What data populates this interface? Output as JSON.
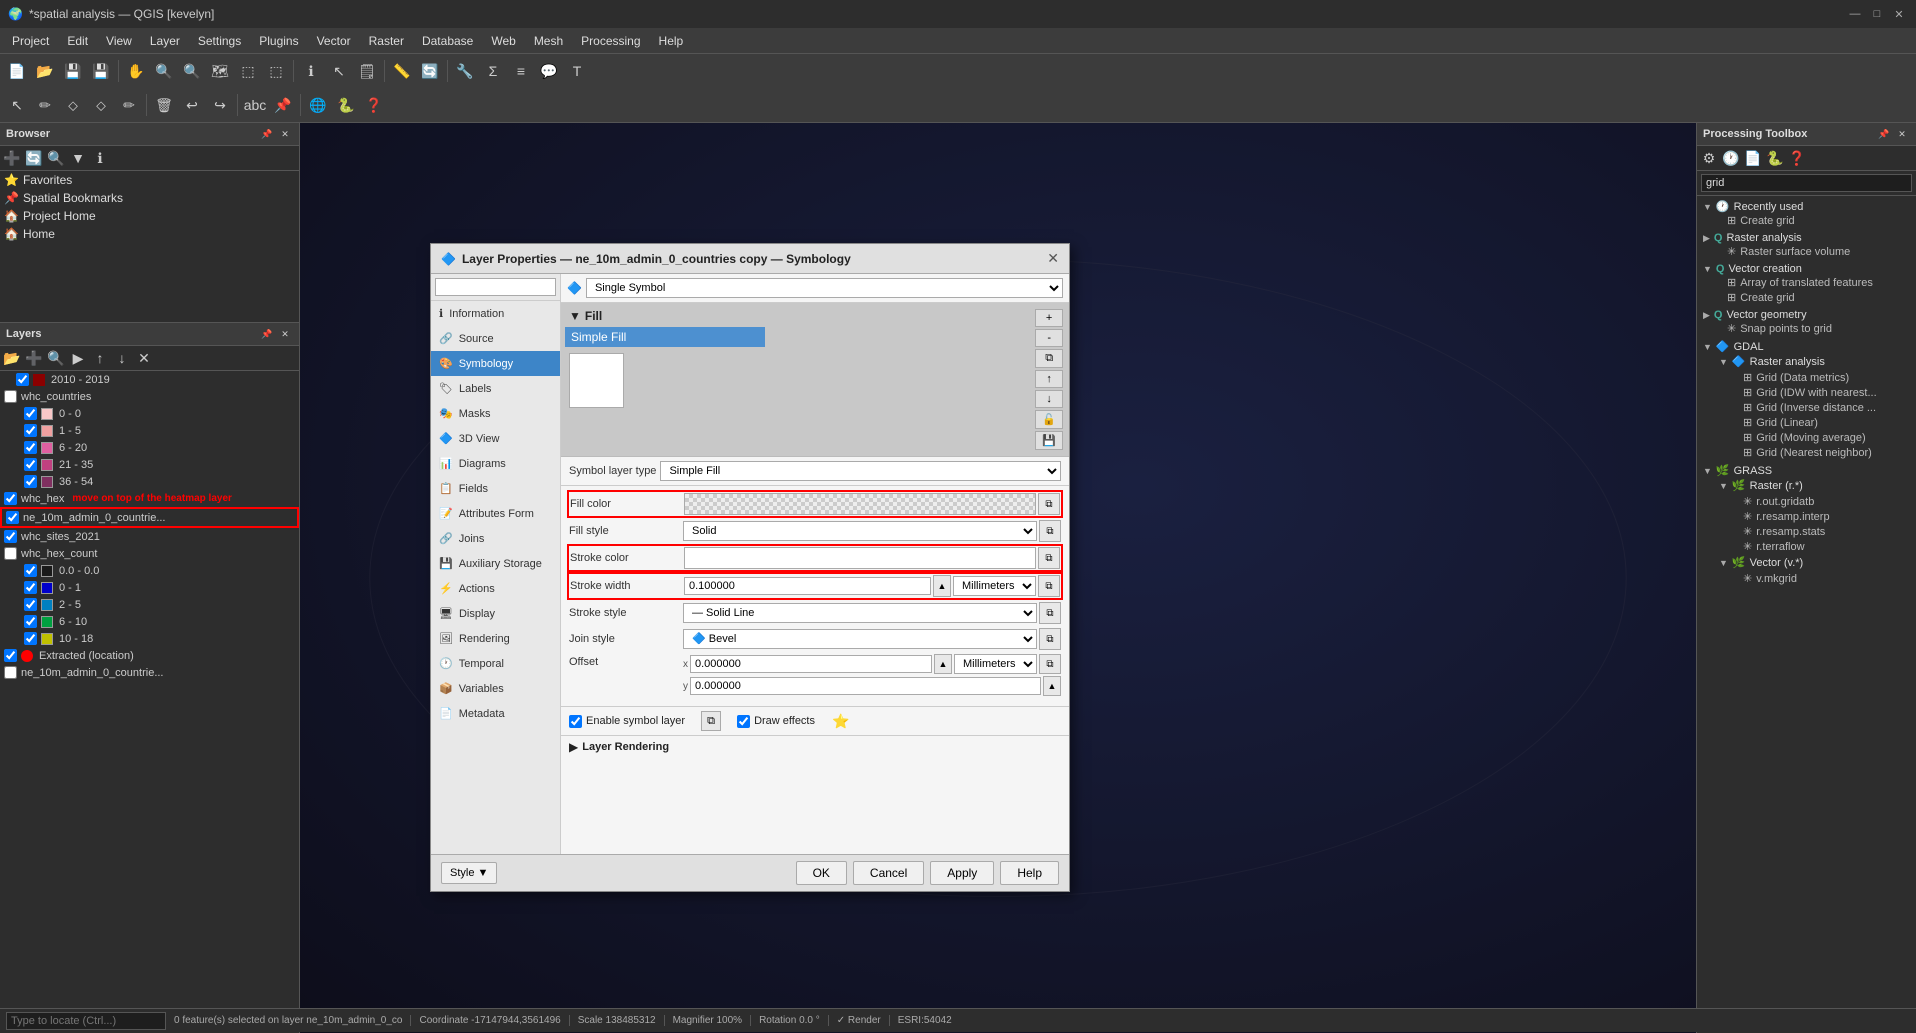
{
  "app": {
    "title": "*spatial analysis — QGIS [kevelyn]",
    "icon": "🌍"
  },
  "titlebar": {
    "minimize": "—",
    "maximize": "□",
    "close": "✕"
  },
  "menu": {
    "items": [
      "Project",
      "Edit",
      "View",
      "Layer",
      "Settings",
      "Plugins",
      "Vector",
      "Raster",
      "Database",
      "Web",
      "Mesh",
      "Processing",
      "Help"
    ]
  },
  "browser": {
    "title": "Browser",
    "items": [
      {
        "label": "Favorites",
        "icon": "⭐"
      },
      {
        "label": "Spatial Bookmarks",
        "icon": "📌"
      },
      {
        "label": "Project Home",
        "icon": "🏠"
      },
      {
        "label": "Home",
        "icon": "🏠"
      }
    ]
  },
  "layers": {
    "title": "Layers",
    "items": [
      {
        "label": "2010 - 2019",
        "color": "#8b0000",
        "checked": true,
        "indent": 1
      },
      {
        "label": "whc_countries",
        "color": null,
        "checked": false,
        "indent": 0
      },
      {
        "label": "0 - 0",
        "color": "#f8c8c8",
        "checked": true,
        "indent": 2
      },
      {
        "label": "1 - 5",
        "color": "#f0a0a0",
        "checked": true,
        "indent": 2
      },
      {
        "label": "6 - 20",
        "color": "#e060a0",
        "checked": true,
        "indent": 2
      },
      {
        "label": "21 - 35",
        "color": "#c04080",
        "checked": true,
        "indent": 2
      },
      {
        "label": "36 - 54",
        "color": "#803060",
        "checked": true,
        "indent": 2
      },
      {
        "label": "whc_hex",
        "color": null,
        "checked": true,
        "indent": 0
      },
      {
        "label": "ne_10m_admin_0_countrie...",
        "color": null,
        "checked": true,
        "indent": 0,
        "selected": true
      },
      {
        "label": "whc_sites_2021",
        "color": null,
        "checked": true,
        "indent": 0
      },
      {
        "label": "whc_hex_count",
        "color": null,
        "checked": false,
        "indent": 0
      },
      {
        "label": "0.0 - 0.0",
        "color": "#1a1a1a",
        "checked": true,
        "indent": 2
      },
      {
        "label": "0 - 1",
        "color": "#0000cc",
        "checked": true,
        "indent": 2
      },
      {
        "label": "2 - 5",
        "color": "#0080c0",
        "checked": true,
        "indent": 2
      },
      {
        "label": "6 - 10",
        "color": "#00a040",
        "checked": true,
        "indent": 2
      },
      {
        "label": "10 - 18",
        "color": "#c0c000",
        "checked": true,
        "indent": 2
      },
      {
        "label": "Extracted (location)",
        "color": "#ff0000",
        "checked": true,
        "indent": 0
      },
      {
        "label": "ne_10m_admin_0_countrie...",
        "color": null,
        "checked": false,
        "indent": 0
      }
    ],
    "annotation": "move on top of the heatmap layer"
  },
  "dialog": {
    "title": "Layer Properties — ne_10m_admin_0_countries copy — Symbology",
    "search_placeholder": "",
    "symbol_type": "Single Symbol",
    "nav_items": [
      {
        "label": "Information",
        "icon": "ℹ"
      },
      {
        "label": "Source",
        "icon": "🔗"
      },
      {
        "label": "Symbology",
        "icon": "🎨"
      },
      {
        "label": "Labels",
        "icon": "🏷"
      },
      {
        "label": "Masks",
        "icon": "🎭"
      },
      {
        "label": "3D View",
        "icon": "🔷"
      },
      {
        "label": "Diagrams",
        "icon": "📊"
      },
      {
        "label": "Fields",
        "icon": "📋"
      },
      {
        "label": "Attributes Form",
        "icon": "📝"
      },
      {
        "label": "Joins",
        "icon": "🔗"
      },
      {
        "label": "Auxiliary Storage",
        "icon": "💾"
      },
      {
        "label": "Actions",
        "icon": "⚡"
      },
      {
        "label": "Display",
        "icon": "🖥"
      },
      {
        "label": "Rendering",
        "icon": "🖼"
      },
      {
        "label": "Temporal",
        "icon": "🕐"
      },
      {
        "label": "Variables",
        "icon": "📦"
      },
      {
        "label": "Metadata",
        "icon": "📄"
      }
    ],
    "symbol_layer_type": "Simple Fill",
    "properties": {
      "fill_color_label": "Fill color",
      "fill_style_label": "Fill style",
      "fill_style_value": "Solid",
      "stroke_color_label": "Stroke color",
      "stroke_width_label": "Stroke width",
      "stroke_width_value": "0.100000",
      "stroke_width_unit": "Millimeters",
      "stroke_style_label": "Stroke style",
      "stroke_style_value": "— Solid Line",
      "join_style_label": "Join style",
      "join_style_value": "🔷 Bevel",
      "offset_label": "Offset",
      "offset_x": "0.000000",
      "offset_y": "0.000000",
      "offset_unit": "Millimeters"
    },
    "checkboxes": {
      "enable_symbol_layer": "Enable symbol layer",
      "draw_effects": "Draw effects"
    },
    "layer_rendering": "Layer Rendering",
    "footer": {
      "style": "Style",
      "ok": "OK",
      "cancel": "Cancel",
      "apply": "Apply",
      "help": "Help"
    }
  },
  "processing": {
    "title": "Processing Toolbox",
    "search_placeholder": "grid",
    "groups": [
      {
        "label": "Recently used",
        "icon": "🕐",
        "expanded": true,
        "items": [
          {
            "label": "Create grid",
            "icon": "⊞"
          }
        ]
      },
      {
        "label": "Raster analysis",
        "icon": "Q",
        "expanded": false,
        "items": [
          {
            "label": "Raster surface volume",
            "icon": "✳"
          }
        ]
      },
      {
        "label": "Vector creation",
        "icon": "Q",
        "expanded": true,
        "items": [
          {
            "label": "Array of translated features",
            "icon": "⊞"
          },
          {
            "label": "Create grid",
            "icon": "⊞"
          }
        ]
      },
      {
        "label": "Vector geometry",
        "icon": "Q",
        "expanded": false,
        "items": [
          {
            "label": "Snap points to grid",
            "icon": "✳"
          }
        ]
      },
      {
        "label": "GDAL",
        "icon": "🔷",
        "expanded": true,
        "items": []
      },
      {
        "label": "Raster analysis",
        "icon": "🔷",
        "expanded": true,
        "subitems": [
          {
            "label": "Grid (Data metrics)",
            "icon": "⊞"
          },
          {
            "label": "Grid (IDW with nearest...",
            "icon": "⊞"
          },
          {
            "label": "Grid (Inverse distance ...",
            "icon": "⊞"
          },
          {
            "label": "Grid (Linear)",
            "icon": "⊞"
          },
          {
            "label": "Grid (Moving average)",
            "icon": "⊞"
          },
          {
            "label": "Grid (Nearest neighbor)",
            "icon": "⊞"
          }
        ]
      },
      {
        "label": "GRASS",
        "icon": "🌿",
        "expanded": true,
        "items": []
      },
      {
        "label": "Raster (r.*)",
        "icon": "🌿",
        "expanded": true,
        "subitems": [
          {
            "label": "r.out.gridatb",
            "icon": "✳"
          },
          {
            "label": "r.resamp.interp",
            "icon": "✳"
          },
          {
            "label": "r.resamp.stats",
            "icon": "✳"
          },
          {
            "label": "r.terraflow",
            "icon": "✳"
          }
        ]
      },
      {
        "label": "Vector (v.*)",
        "icon": "🌿",
        "expanded": true,
        "subitems": [
          {
            "label": "v.mkgrid",
            "icon": "✳"
          }
        ]
      }
    ]
  },
  "statusbar": {
    "features": "0 feature(s) selected on layer ne_10m_admin_0_co",
    "coordinate": "Coordinate  -17147944,3561496",
    "scale": "Scale 138485312",
    "magnifier": "Magnifier 100%",
    "rotation": "Rotation 0.0 °",
    "render": "✓ Render",
    "crs": "ESRI:54042"
  },
  "locate": {
    "placeholder": "Type to locate (Ctrl...)"
  }
}
